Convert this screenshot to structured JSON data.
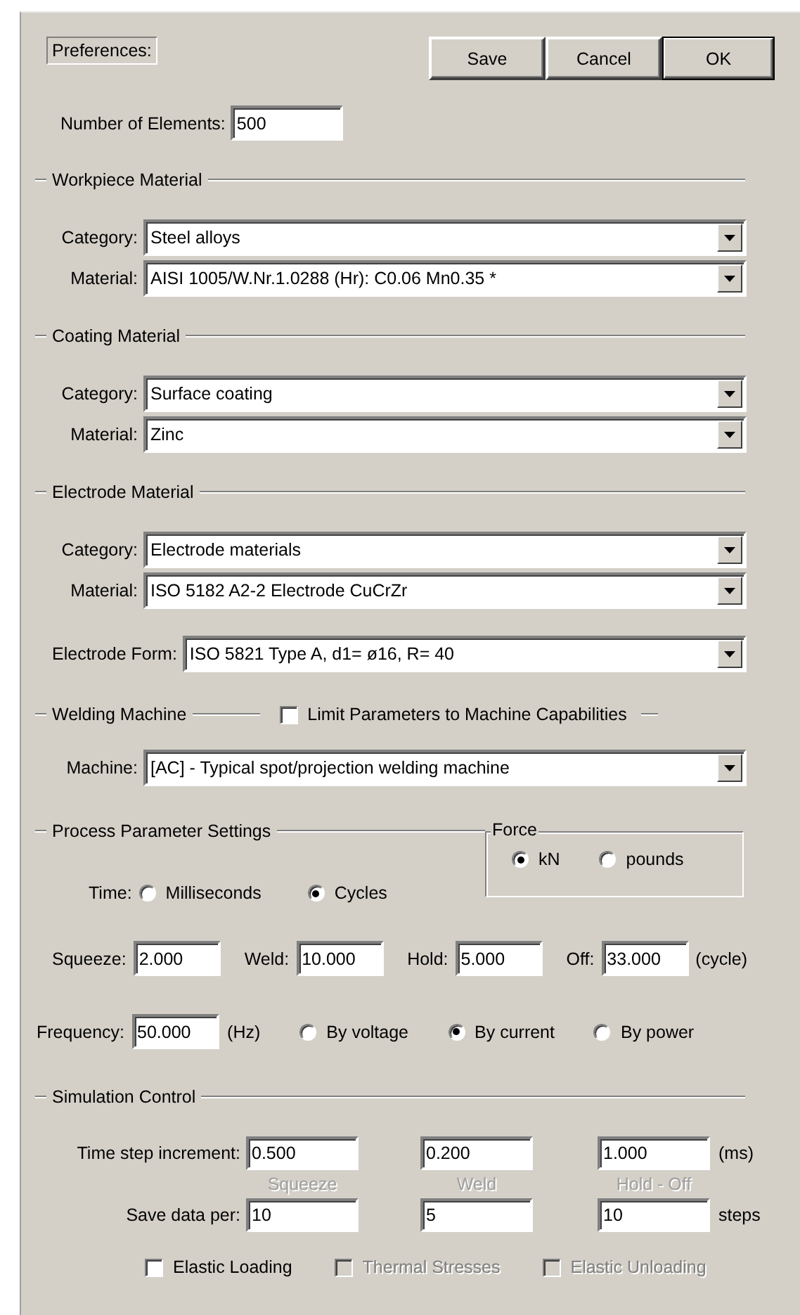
{
  "header": {
    "title": "Preferences:",
    "buttons": [
      {
        "label": "Save",
        "default": false
      },
      {
        "label": "Cancel",
        "default": false
      },
      {
        "label": "OK",
        "default": true
      }
    ]
  },
  "number_of_elements": {
    "label": "Number of Elements:",
    "value": "500"
  },
  "material_sections": [
    {
      "title": "Workpiece Material",
      "fields": [
        {
          "label": "Category:",
          "value": "Steel alloys"
        },
        {
          "label": "Material:",
          "value": "AISI 1005/W.Nr.1.0288 (Hr): C0.06 Mn0.35 *"
        }
      ]
    },
    {
      "title": "Coating Material",
      "fields": [
        {
          "label": "Category:",
          "value": "Surface coating"
        },
        {
          "label": "Material:",
          "value": "Zinc"
        }
      ]
    },
    {
      "title": "Electrode Material",
      "fields": [
        {
          "label": "Category:",
          "value": "Electrode materials"
        },
        {
          "label": "Material:",
          "value": "ISO 5182   A2-2 Electrode CuCrZr"
        }
      ],
      "form": {
        "label": "Electrode Form:",
        "value": "ISO 5821 Type A,  d1= ø16,  R= 40"
      }
    }
  ],
  "welding_machine": {
    "title": "Welding Machine",
    "limit": {
      "label": "Limit Parameters to Machine Capabilities",
      "checked": false
    },
    "machine": {
      "label": "Machine:",
      "value": "[AC] - Typical spot/projection welding machine"
    }
  },
  "process": {
    "title": "Process Parameter Settings",
    "force": {
      "title": "Force",
      "options": [
        {
          "label": "kN",
          "selected": true
        },
        {
          "label": "pounds",
          "selected": false
        }
      ]
    },
    "time": {
      "label": "Time:",
      "options": [
        {
          "label": "Milliseconds",
          "selected": false
        },
        {
          "label": "Cycles",
          "selected": true
        }
      ]
    },
    "durations": [
      {
        "label": "Squeeze:",
        "value": "2.000"
      },
      {
        "label": "Weld:",
        "value": "10.000"
      },
      {
        "label": "Hold:",
        "value": "5.000"
      },
      {
        "label": "Off:",
        "value": "33.000"
      }
    ],
    "duration_unit": "(cycle)",
    "frequency": {
      "label": "Frequency:",
      "value": "50.000",
      "unit": "(Hz)"
    },
    "control_modes": [
      {
        "label": "By voltage",
        "selected": false
      },
      {
        "label": "By current",
        "selected": true
      },
      {
        "label": "By power",
        "selected": false
      }
    ]
  },
  "simulation": {
    "title": "Simulation Control",
    "time_step": {
      "label": "Time step increment:",
      "values": [
        "0.500",
        "0.200",
        "1.000"
      ],
      "unit": "(ms)"
    },
    "phases": [
      "Squeeze",
      "Weld",
      "Hold - Off"
    ],
    "save_data": {
      "label": "Save data per:",
      "values": [
        "10",
        "5",
        "10"
      ],
      "unit": "steps"
    },
    "options": [
      {
        "label": "Elastic Loading",
        "checked": false,
        "disabled": false
      },
      {
        "label": "Thermal Stresses",
        "checked": false,
        "disabled": true
      },
      {
        "label": "Elastic Unloading",
        "checked": false,
        "disabled": true
      }
    ]
  }
}
